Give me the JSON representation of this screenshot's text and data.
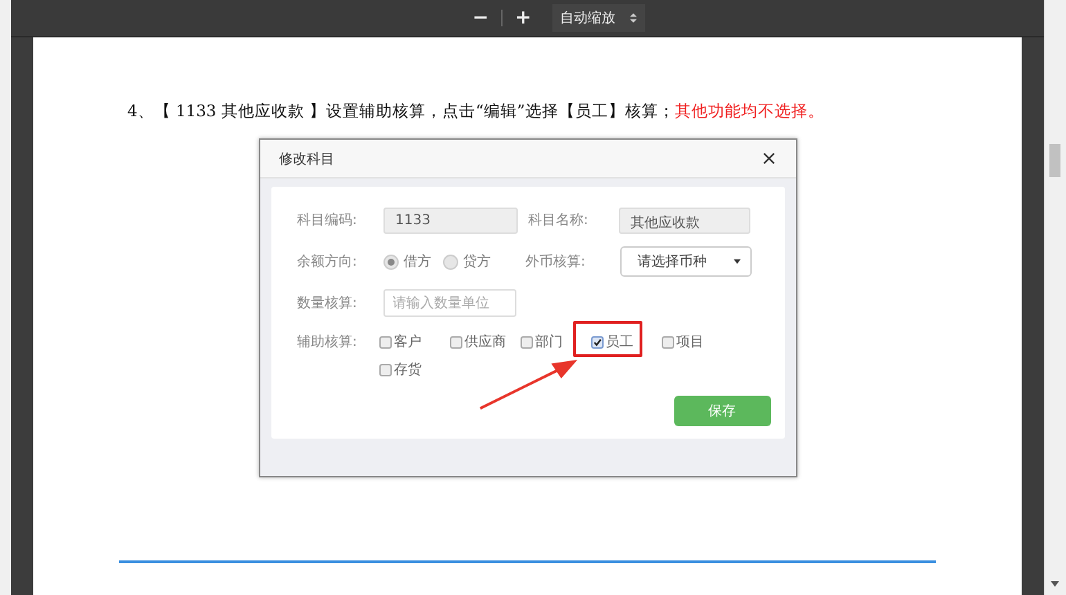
{
  "toolbar": {
    "zoom_out": "−",
    "zoom_in": "+",
    "zoom_select": "自动缩放"
  },
  "instruction": {
    "text": "4、【 1133 其他应收款 】设置辅助核算，点击“编辑”选择【员工】核算；",
    "emphasis": "其他功能均不选择。"
  },
  "dialog": {
    "title": "修改科目",
    "code": {
      "label": "科目编码:",
      "value": "1133"
    },
    "name": {
      "label": "科目名称:",
      "value": "其他应收款"
    },
    "balance": {
      "label": "余额方向:",
      "options": [
        {
          "label": "借方",
          "selected": true
        },
        {
          "label": "贷方",
          "selected": false
        }
      ]
    },
    "currency": {
      "label": "外币核算:",
      "value": "请选择币种"
    },
    "quantity": {
      "label": "数量核算:",
      "placeholder": "请输入数量单位"
    },
    "auxiliary": {
      "label": "辅助核算:",
      "options": [
        {
          "label": "客户",
          "checked": false,
          "highlighted": false
        },
        {
          "label": "供应商",
          "checked": false,
          "highlighted": false
        },
        {
          "label": "部门",
          "checked": false,
          "highlighted": false
        },
        {
          "label": "员工",
          "checked": true,
          "highlighted": true
        },
        {
          "label": "项目",
          "checked": false,
          "highlighted": false
        },
        {
          "label": "存货",
          "checked": false,
          "highlighted": false
        }
      ]
    },
    "save": "保存"
  }
}
